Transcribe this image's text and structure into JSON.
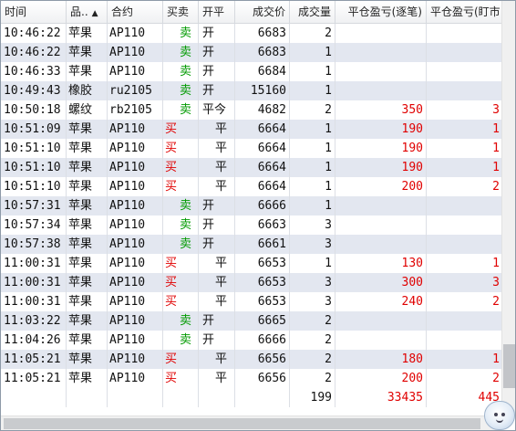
{
  "columns": {
    "time": "时间",
    "product": "品..",
    "contract": "合约",
    "side": "买卖",
    "open_close": "开平",
    "price": "成交价",
    "volume": "成交量",
    "pnl_trade": "平仓盈亏(逐笔)",
    "pnl_mtm": "平仓盈亏(盯市"
  },
  "sort_indicator": "▲",
  "rows": [
    {
      "time": "10:46:22",
      "product": "苹果",
      "contract": "AP110",
      "side": "卖",
      "open_close": "开",
      "price": "6683",
      "volume": "2",
      "pnl_trade": "",
      "pnl_mtm": ""
    },
    {
      "time": "10:46:22",
      "product": "苹果",
      "contract": "AP110",
      "side": "卖",
      "open_close": "开",
      "price": "6683",
      "volume": "1",
      "pnl_trade": "",
      "pnl_mtm": ""
    },
    {
      "time": "10:46:33",
      "product": "苹果",
      "contract": "AP110",
      "side": "卖",
      "open_close": "开",
      "price": "6684",
      "volume": "1",
      "pnl_trade": "",
      "pnl_mtm": ""
    },
    {
      "time": "10:49:43",
      "product": "橡胶",
      "contract": "ru2105",
      "side": "卖",
      "open_close": "开",
      "price": "15160",
      "volume": "1",
      "pnl_trade": "",
      "pnl_mtm": ""
    },
    {
      "time": "10:50:18",
      "product": "螺纹",
      "contract": "rb2105",
      "side": "卖",
      "open_close": "平今",
      "price": "4682",
      "volume": "2",
      "pnl_trade": "350",
      "pnl_mtm": "3"
    },
    {
      "time": "10:51:09",
      "product": "苹果",
      "contract": "AP110",
      "side": "买",
      "open_close": "平",
      "price": "6664",
      "volume": "1",
      "pnl_trade": "190",
      "pnl_mtm": "1"
    },
    {
      "time": "10:51:10",
      "product": "苹果",
      "contract": "AP110",
      "side": "买",
      "open_close": "平",
      "price": "6664",
      "volume": "1",
      "pnl_trade": "190",
      "pnl_mtm": "1"
    },
    {
      "time": "10:51:10",
      "product": "苹果",
      "contract": "AP110",
      "side": "买",
      "open_close": "平",
      "price": "6664",
      "volume": "1",
      "pnl_trade": "190",
      "pnl_mtm": "1"
    },
    {
      "time": "10:51:10",
      "product": "苹果",
      "contract": "AP110",
      "side": "买",
      "open_close": "平",
      "price": "6664",
      "volume": "1",
      "pnl_trade": "200",
      "pnl_mtm": "2"
    },
    {
      "time": "10:57:31",
      "product": "苹果",
      "contract": "AP110",
      "side": "卖",
      "open_close": "开",
      "price": "6666",
      "volume": "1",
      "pnl_trade": "",
      "pnl_mtm": ""
    },
    {
      "time": "10:57:34",
      "product": "苹果",
      "contract": "AP110",
      "side": "卖",
      "open_close": "开",
      "price": "6663",
      "volume": "3",
      "pnl_trade": "",
      "pnl_mtm": ""
    },
    {
      "time": "10:57:38",
      "product": "苹果",
      "contract": "AP110",
      "side": "卖",
      "open_close": "开",
      "price": "6661",
      "volume": "3",
      "pnl_trade": "",
      "pnl_mtm": ""
    },
    {
      "time": "11:00:31",
      "product": "苹果",
      "contract": "AP110",
      "side": "买",
      "open_close": "平",
      "price": "6653",
      "volume": "1",
      "pnl_trade": "130",
      "pnl_mtm": "1"
    },
    {
      "time": "11:00:31",
      "product": "苹果",
      "contract": "AP110",
      "side": "买",
      "open_close": "平",
      "price": "6653",
      "volume": "3",
      "pnl_trade": "300",
      "pnl_mtm": "3"
    },
    {
      "time": "11:00:31",
      "product": "苹果",
      "contract": "AP110",
      "side": "买",
      "open_close": "平",
      "price": "6653",
      "volume": "3",
      "pnl_trade": "240",
      "pnl_mtm": "2"
    },
    {
      "time": "11:03:22",
      "product": "苹果",
      "contract": "AP110",
      "side": "卖",
      "open_close": "开",
      "price": "6665",
      "volume": "2",
      "pnl_trade": "",
      "pnl_mtm": ""
    },
    {
      "time": "11:04:26",
      "product": "苹果",
      "contract": "AP110",
      "side": "卖",
      "open_close": "开",
      "price": "6666",
      "volume": "2",
      "pnl_trade": "",
      "pnl_mtm": ""
    },
    {
      "time": "11:05:21",
      "product": "苹果",
      "contract": "AP110",
      "side": "买",
      "open_close": "平",
      "price": "6656",
      "volume": "2",
      "pnl_trade": "180",
      "pnl_mtm": "1"
    },
    {
      "time": "11:05:21",
      "product": "苹果",
      "contract": "AP110",
      "side": "买",
      "open_close": "平",
      "price": "6656",
      "volume": "2",
      "pnl_trade": "200",
      "pnl_mtm": "2"
    }
  ],
  "totals": {
    "volume": "199",
    "pnl_trade": "33435",
    "pnl_mtm": "445"
  },
  "colors": {
    "buy": "#e00000",
    "sell": "#009a00",
    "alt_row": "#e3e7f0",
    "pnl": "#e00000"
  },
  "icons": {
    "corner": "assistant-face-icon"
  }
}
